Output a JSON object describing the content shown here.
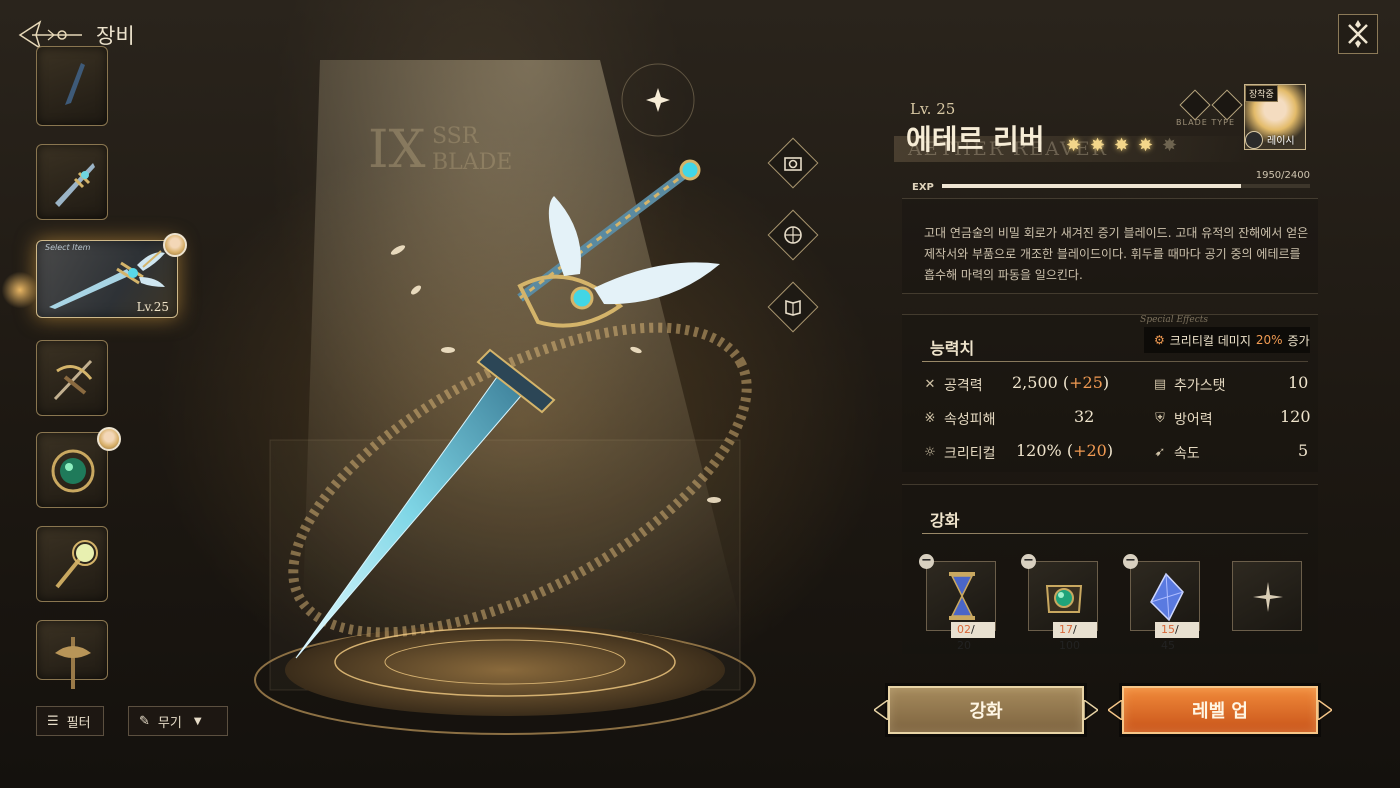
{
  "header": {
    "title": "장비"
  },
  "list": {
    "selected_tag": "Select Item",
    "selected_level": "Lv.25",
    "filter_label": "필터",
    "type_label": "무기"
  },
  "stage": {
    "grade_roman": "IX",
    "grade_tier": "SSR",
    "grade_class": "BLADE"
  },
  "item": {
    "level": "Lv. 25",
    "name": "에테르 리버",
    "name_en": "AETHER REAVER",
    "stars": 4,
    "max_stars": 5,
    "type_caption": "BLADE TYPE",
    "equipped_tag": "장착중",
    "equipped_by": "레이시",
    "exp_label": "EXP",
    "exp_current": 1950,
    "exp_max": 2400,
    "exp_text": "1950/2400",
    "description": "고대 연금술의 비밀 회로가 새겨진 증기 블레이드. 고대 유적의 잔해에서 얻은 제작서와 부품으로 개조한 블레이드이다. 휘두를 때마다 공기 중의 에테르를 흡수해 마력의 파동을 일으킨다."
  },
  "stats": {
    "title": "능력치",
    "effect_caption": "Special Effects",
    "effect_prefix": "크리티컬 데미지",
    "effect_value": "20%",
    "effect_suffix": "증가",
    "attack": {
      "label": "공격력",
      "value": "2,500",
      "bonus": "+25"
    },
    "elemental": {
      "label": "속성피해",
      "value": "32"
    },
    "critical": {
      "label": "크리티컬",
      "value": "120%",
      "bonus": "+20"
    },
    "extra": {
      "label": "추가스탯",
      "value": "10"
    },
    "defense": {
      "label": "방어력",
      "value": "120"
    },
    "speed": {
      "label": "속도",
      "value": "5"
    }
  },
  "enhance": {
    "title": "강화",
    "materials": [
      {
        "name": "hourglass",
        "current": "02",
        "required": "/ 20"
      },
      {
        "name": "emerald-emblem",
        "current": "17",
        "required": "/ 100"
      },
      {
        "name": "blue-crystal",
        "current": "15",
        "required": "/ 45"
      }
    ]
  },
  "buttons": {
    "enhance": "강화",
    "level_up": "레벨 업"
  },
  "colors": {
    "accent_orange": "#f09a52",
    "gold": "#cfb98a"
  }
}
